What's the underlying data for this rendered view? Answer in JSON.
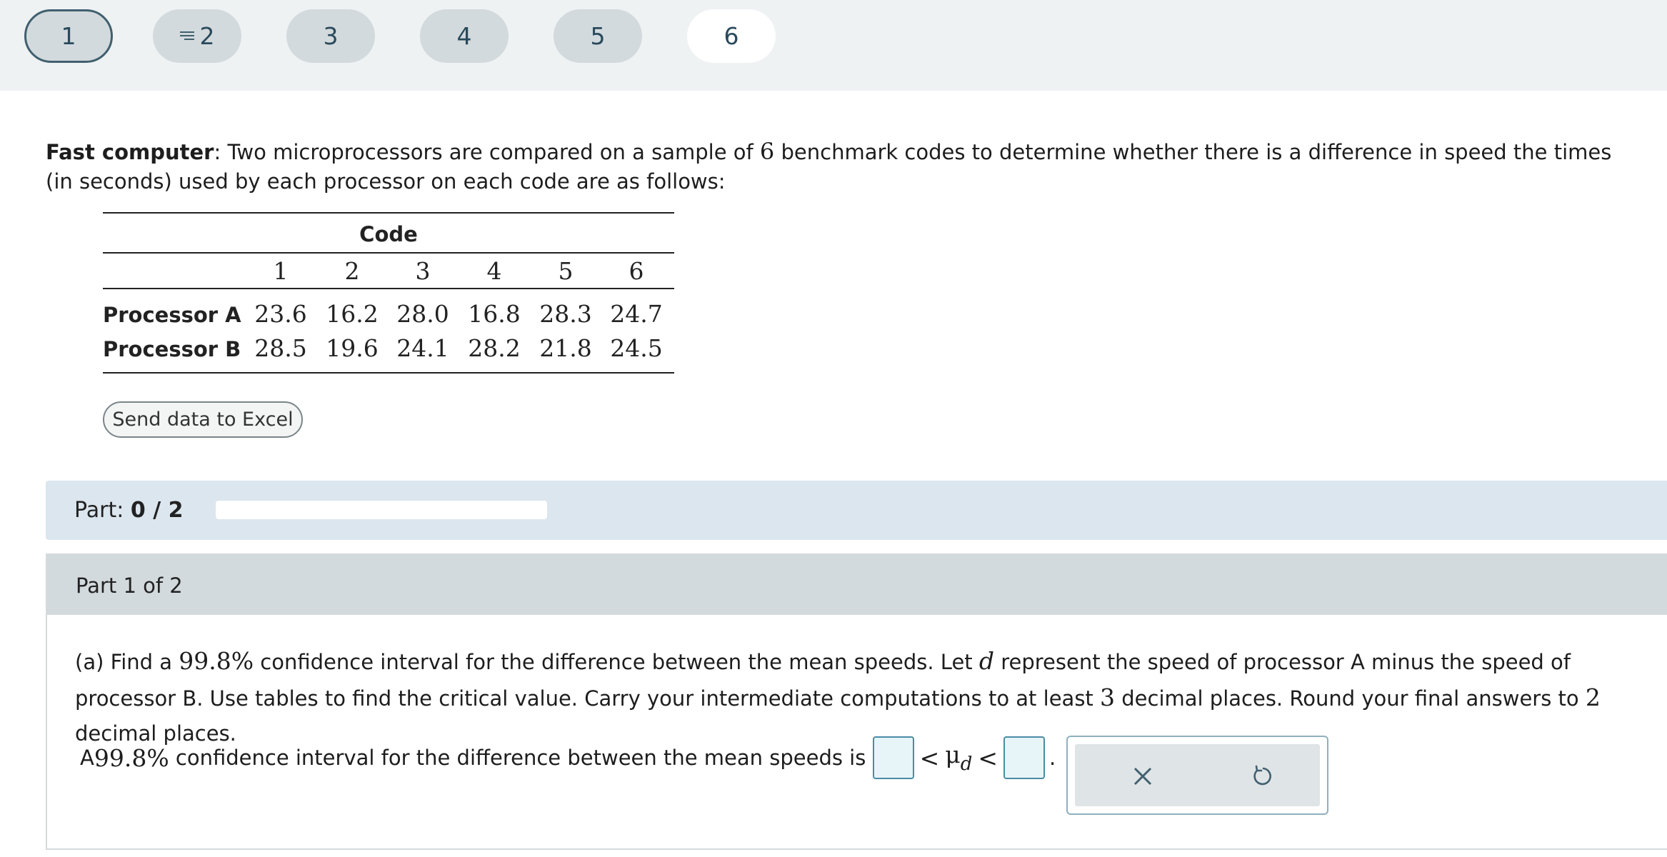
{
  "nav": {
    "questions": [
      {
        "label": "1",
        "state": "current"
      },
      {
        "label": "2",
        "state": "default",
        "icon": "list-icon"
      },
      {
        "label": "3",
        "state": "default"
      },
      {
        "label": "4",
        "state": "default"
      },
      {
        "label": "5",
        "state": "default"
      },
      {
        "label": "6",
        "state": "active"
      }
    ]
  },
  "problem": {
    "title": "Fast computer",
    "text_a": ": Two microprocessors are compared on a sample of ",
    "sample_n": "6",
    "text_b": " benchmark codes to determine whether there is a difference in speed the times (in seconds) used by each processor on each code are as follows:"
  },
  "table": {
    "header": "Code",
    "codes": [
      "1",
      "2",
      "3",
      "4",
      "5",
      "6"
    ],
    "rows": [
      {
        "label": "Processor A",
        "values": [
          "23.6",
          "16.2",
          "28.0",
          "16.8",
          "28.3",
          "24.7"
        ]
      },
      {
        "label": "Processor B",
        "values": [
          "28.5",
          "19.6",
          "24.1",
          "28.2",
          "21.8",
          "24.5"
        ]
      }
    ]
  },
  "excel_button": "Send data to Excel",
  "progress": {
    "label": "Part: ",
    "value": "0 / 2",
    "fraction": 0
  },
  "part": {
    "heading": "Part 1 of 2",
    "q1": "(a) Find a ",
    "conf": "99.8%",
    "q2": " confidence interval for the difference between the mean speeds. Let ",
    "var": "d",
    "q3": " represent the speed of processor A minus the speed of processor B. Use tables to find the critical value. Carry your intermediate computations to at least ",
    "dp1": "3",
    "q4": " decimal places. Round your final answers to ",
    "dp2": "2",
    "q5": " decimal places."
  },
  "answer": {
    "prefix": "A ",
    "conf": "99.8%",
    "text": " confidence interval for the difference between the mean speeds is ",
    "lt": "<",
    "mu": "μ",
    "mu_sub": "d",
    "period": ".",
    "lower_value": "",
    "upper_value": ""
  },
  "tools": {
    "clear_icon": "close-icon",
    "undo_icon": "undo-icon"
  },
  "colors": {
    "topbar": "#eef2f3",
    "nav_button": "#d3dadd",
    "progress_bg": "#dbe6ee",
    "part_header": "#d3dadd",
    "answer_border": "#4a8ca6"
  }
}
